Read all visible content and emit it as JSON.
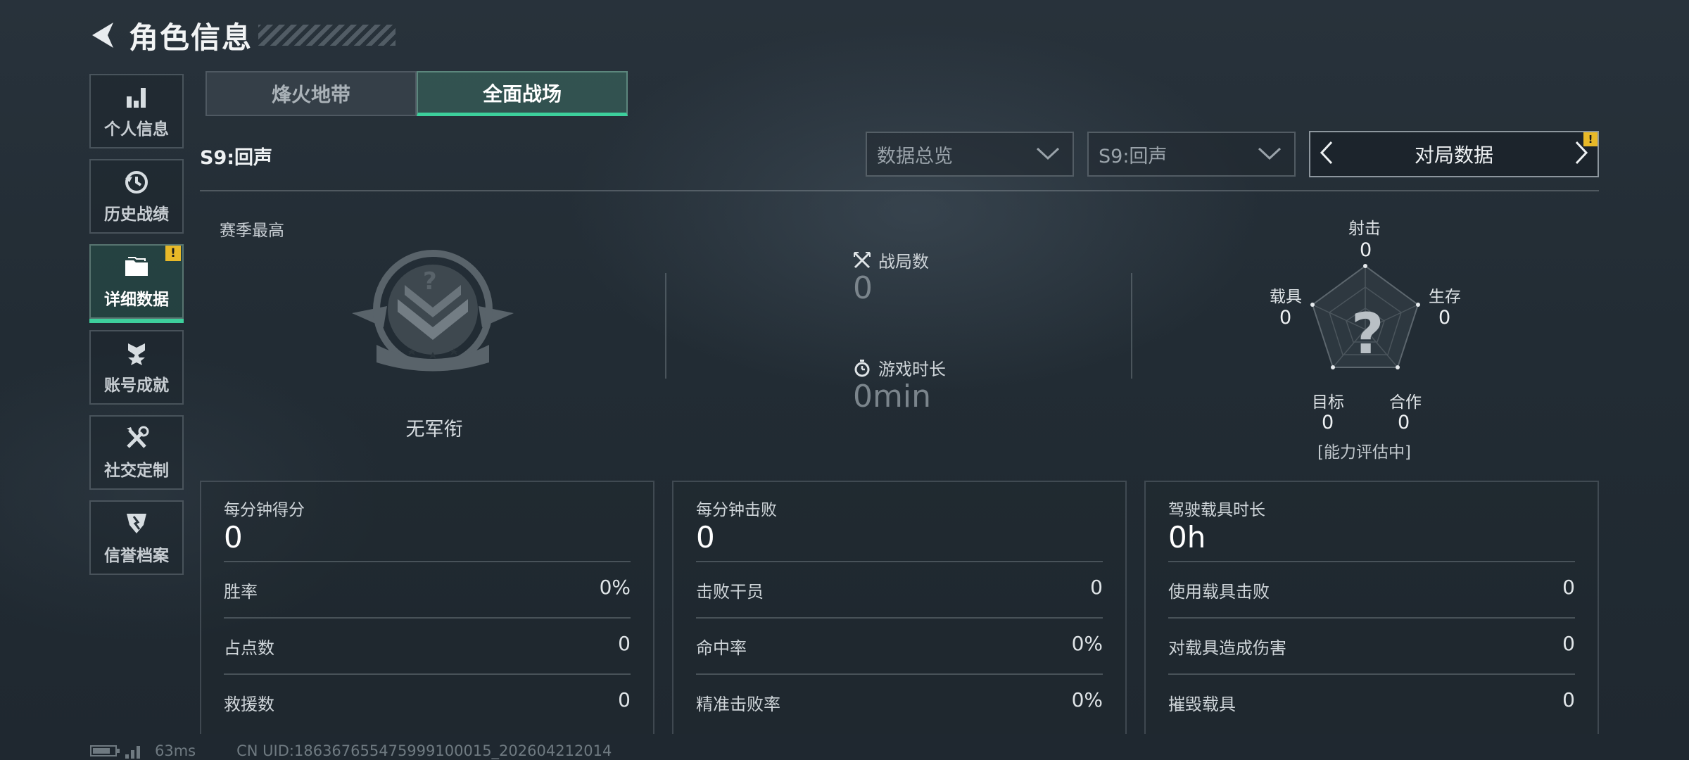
{
  "header": {
    "title": "角色信息"
  },
  "sidebar": {
    "items": [
      {
        "label": "个人信息",
        "icon": "bar-chart-icon"
      },
      {
        "label": "历史战绩",
        "icon": "history-icon"
      },
      {
        "label": "详细数据",
        "icon": "folder-icon",
        "active": true,
        "badge": "!"
      },
      {
        "label": "账号成就",
        "icon": "medal-icon"
      },
      {
        "label": "社交定制",
        "icon": "tools-icon"
      },
      {
        "label": "信誉档案",
        "icon": "shield-icon"
      }
    ]
  },
  "tabs": [
    {
      "label": "烽火地带",
      "active": false
    },
    {
      "label": "全面战场",
      "active": true
    }
  ],
  "season_label": "S9:回声",
  "filters": {
    "category": "数据总览",
    "season": "S9:回声",
    "pager_label": "对局数据",
    "pager_badge": "!"
  },
  "overview": {
    "season_best_label": "赛季最高",
    "rank_name": "无军衔",
    "battles": {
      "label": "战局数",
      "value": "0"
    },
    "playtime": {
      "label": "游戏时长",
      "value": "0min"
    }
  },
  "radar": {
    "center_symbol": "?",
    "axes": [
      {
        "label": "射击",
        "value": "0"
      },
      {
        "label": "生存",
        "value": "0"
      },
      {
        "label": "合作",
        "value": "0"
      },
      {
        "label": "目标",
        "value": "0"
      },
      {
        "label": "载具",
        "value": "0"
      }
    ],
    "status": "[能力评估中]"
  },
  "cards": [
    {
      "title": "每分钟得分",
      "value": "0",
      "rows": [
        {
          "label": "胜率",
          "value": "0%"
        },
        {
          "label": "占点数",
          "value": "0"
        },
        {
          "label": "救援数",
          "value": "0"
        }
      ]
    },
    {
      "title": "每分钟击败",
      "value": "0",
      "rows": [
        {
          "label": "击败干员",
          "value": "0"
        },
        {
          "label": "命中率",
          "value": "0%"
        },
        {
          "label": "精准击败率",
          "value": "0%"
        }
      ]
    },
    {
      "title": "驾驶载具时长",
      "value": "0h",
      "rows": [
        {
          "label": "使用载具击败",
          "value": "0"
        },
        {
          "label": "对载具造成伤害",
          "value": "0"
        },
        {
          "label": "摧毁载具",
          "value": "0"
        }
      ]
    }
  ],
  "footer": {
    "ping": "63ms",
    "uid": "CN UID:186367655475999100015_202604212014"
  },
  "colors": {
    "accent": "#3dcf9c",
    "warning": "#e8b928"
  }
}
